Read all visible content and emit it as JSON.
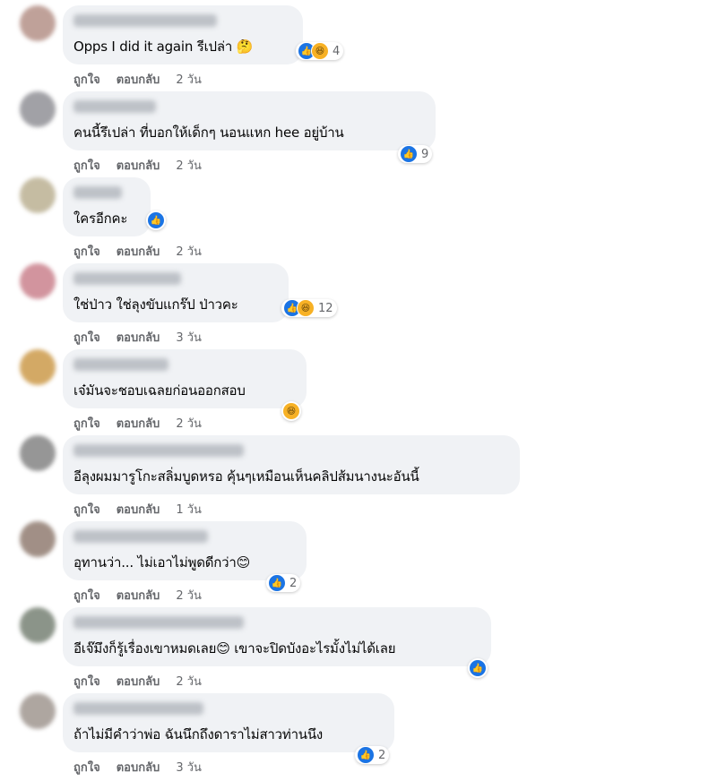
{
  "actions": {
    "like": "ถูกใจ",
    "reply": "ตอบกลับ"
  },
  "colors": {
    "bubble": "#f0f2f5",
    "like_blue": "#1b74e4",
    "haha_yellow": "#f7b125",
    "meta_gray": "#65676b"
  },
  "comments": [
    {
      "text": "Opps I did it again รีเปล่า 🤔",
      "time": "2 วัน",
      "reactions": [
        "like-icon",
        "haha-icon"
      ],
      "count": "4"
    },
    {
      "text": "คนนี้รึเปล่า ที่บอกให้เด็กๆ นอนแหก hee อยู่บ้าน",
      "time": "2 วัน",
      "reactions": [
        "like-icon"
      ],
      "count": "9"
    },
    {
      "text": "ใครอีกคะ",
      "time": "2 วัน",
      "reactions": [
        "like-icon"
      ]
    },
    {
      "text": "ใช่ป่าว ใช่ลุงขับแกร๊ป ป่าวคะ",
      "time": "3 วัน",
      "reactions": [
        "like-icon",
        "haha-icon"
      ],
      "count": "12"
    },
    {
      "text": "เจ๋มันจะชอบเฉลยก่อนออกสอบ",
      "time": "2 วัน",
      "reactions": [
        "haha-icon"
      ]
    },
    {
      "text": "อีลุงผมมารูโกะสลิ่มบูดหรอ คุ้นๆเหมือนเห็นคลิปส้มนางนะอันนี้",
      "time": "1 วัน",
      "reactions": []
    },
    {
      "text": "อุทานว่า... ไม่เอาไม่พูดดีกว่า😊",
      "time": "2 วัน",
      "reactions": [
        "like-icon"
      ],
      "count": "2"
    },
    {
      "text": "อีเจ๊มึงก็รู้เรื่องเขาหมดเลย😊 เขาจะปิดบังอะไรมั้งไม่ได้เลย",
      "time": "2 วัน",
      "reactions": [
        "like-icon"
      ]
    },
    {
      "text": "ถ้าไม่มีคำว่าพ่อ ฉันนึกถึงดาราไม่สาวท่านนึง",
      "time": "3 วัน",
      "reactions": [
        "like-icon"
      ],
      "count": "2"
    }
  ]
}
